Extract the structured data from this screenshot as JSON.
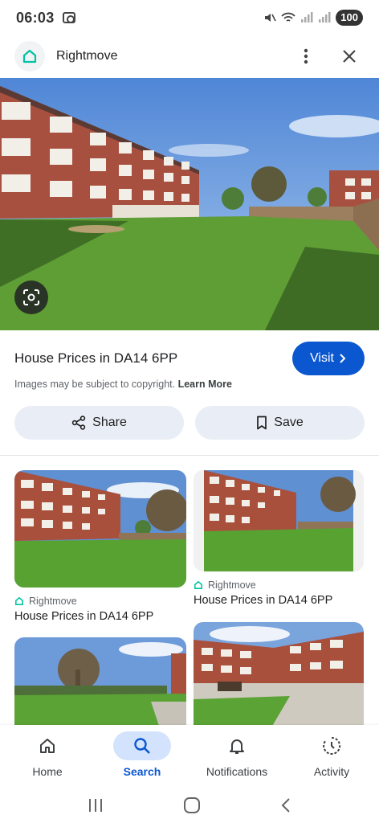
{
  "status_bar": {
    "time": "06:03",
    "battery": "100"
  },
  "header": {
    "site_name": "Rightmove",
    "logo_icon": "rightmove-house-icon",
    "menu_icon": "more-vert-icon",
    "close_icon": "close-icon"
  },
  "result_main": {
    "title": "House Prices in DA14 6PP",
    "visit_label": "Visit",
    "copyright_text": "Images may be subject to copyright.",
    "learn_more": "Learn More"
  },
  "actions": {
    "share_label": "Share",
    "save_label": "Save"
  },
  "related": [
    {
      "source": "Rightmove",
      "title": "House Prices in DA14 6PP"
    },
    {
      "source": "Rightmove",
      "title": "House Prices in DA14 6PP"
    }
  ],
  "bottom_nav": [
    {
      "label": "Home",
      "icon": "home-icon"
    },
    {
      "label": "Search",
      "icon": "search-icon",
      "active": true
    },
    {
      "label": "Notifications",
      "icon": "bell-icon"
    },
    {
      "label": "Activity",
      "icon": "activity-icon"
    }
  ],
  "colors": {
    "accent": "#0b57d0",
    "pill_bg": "#e9eef6",
    "brand": "#00deb6"
  }
}
